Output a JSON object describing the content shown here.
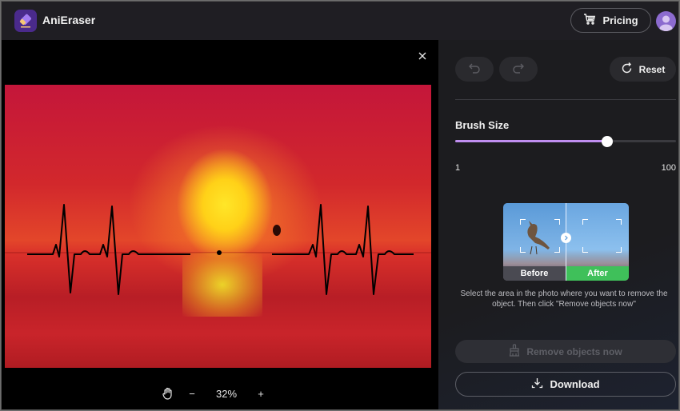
{
  "app": {
    "title": "AniEraser",
    "brand_color": "#4a2a8c",
    "accent_color": "#c08ef0"
  },
  "header": {
    "pricing_label": "Pricing",
    "pricing_icon": "cart-icon",
    "avatar_icon": "user-avatar-icon"
  },
  "canvas": {
    "close_icon": "close-icon",
    "zoom": {
      "pan_icon": "hand-icon",
      "zoom_out_label": "−",
      "zoom_level": "32%",
      "zoom_in_label": "+"
    }
  },
  "panel": {
    "undo_icon": "undo-icon",
    "redo_icon": "redo-icon",
    "reset_label": "Reset",
    "brush": {
      "label": "Brush Size",
      "min": 1,
      "max": 100,
      "min_label": "1",
      "max_label": "100",
      "value": 69
    },
    "demo": {
      "before_label": "Before",
      "after_label": "After",
      "after_color": "#3fc05a"
    },
    "hint": "Select the area in the photo where you want to remove the object. Then click \"Remove objects now\"",
    "remove_label": "Remove objects now",
    "remove_enabled": false,
    "download_label": "Download"
  }
}
